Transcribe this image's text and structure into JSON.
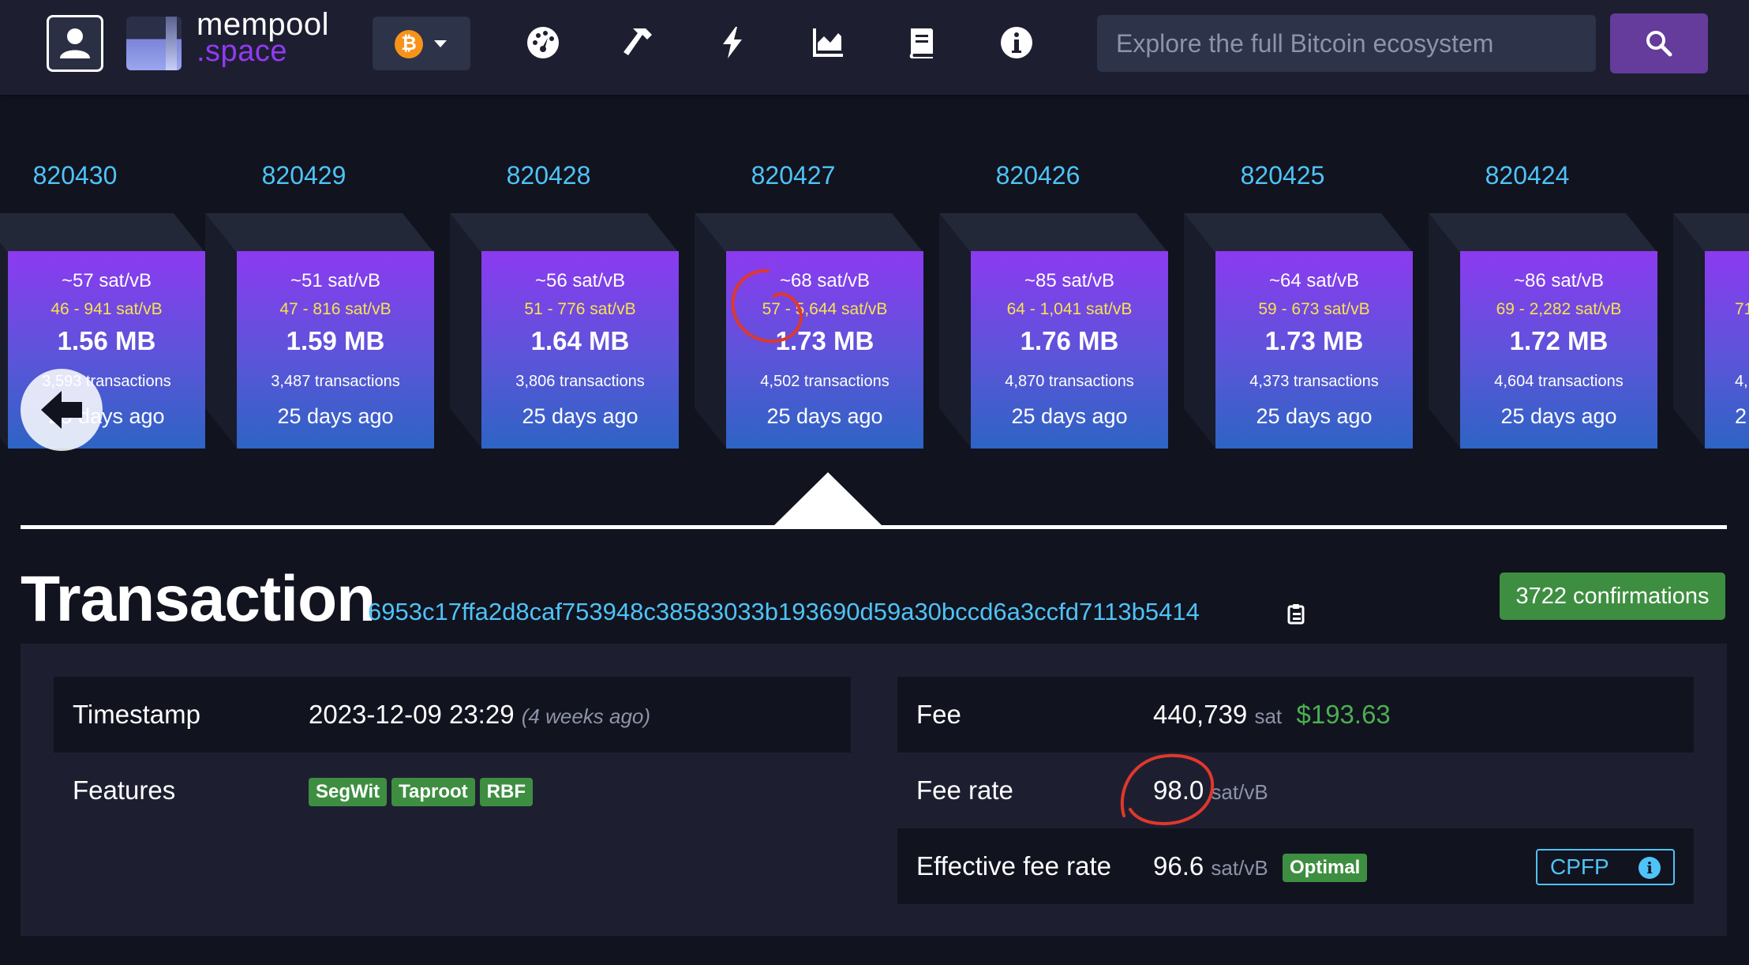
{
  "header": {
    "logo_line1": "mempool",
    "logo_line2": ".space",
    "network_symbol": "₿",
    "nav_icons": [
      "dashboard-icon",
      "mining-hammer-icon",
      "lightning-icon",
      "graphs-icon",
      "docs-book-icon",
      "about-info-icon"
    ],
    "search_placeholder": "Explore the full Bitcoin ecosystem"
  },
  "blocks": [
    {
      "height": "820430",
      "median_fee": "~57 sat/vB",
      "fee_range": "46 - 941 sat/vB",
      "size": "1.56 MB",
      "tx_count": "3,593 transactions",
      "time": "25 days ago"
    },
    {
      "height": "820429",
      "median_fee": "~51 sat/vB",
      "fee_range": "47 - 816 sat/vB",
      "size": "1.59 MB",
      "tx_count": "3,487 transactions",
      "time": "25 days ago"
    },
    {
      "height": "820428",
      "median_fee": "~56 sat/vB",
      "fee_range": "51 - 776 sat/vB",
      "size": "1.64 MB",
      "tx_count": "3,806 transactions",
      "time": "25 days ago"
    },
    {
      "height": "820427",
      "median_fee": "~68 sat/vB",
      "fee_range": "57 - 5,644 sat/vB",
      "size": "1.73 MB",
      "tx_count": "4,502 transactions",
      "time": "25 days ago"
    },
    {
      "height": "820426",
      "median_fee": "~85 sat/vB",
      "fee_range": "64 - 1,041 sat/vB",
      "size": "1.76 MB",
      "tx_count": "4,870 transactions",
      "time": "25 days ago"
    },
    {
      "height": "820425",
      "median_fee": "~64 sat/vB",
      "fee_range": "59 - 673 sat/vB",
      "size": "1.73 MB",
      "tx_count": "4,373 transactions",
      "time": "25 days ago"
    },
    {
      "height": "820424",
      "median_fee": "~86 sat/vB",
      "fee_range": "69 - 2,282 sat/vB",
      "size": "1.72 MB",
      "tx_count": "4,604 transactions",
      "time": "25 days ago"
    },
    {
      "height": "8",
      "median_fee": "",
      "fee_range": "71",
      "size": "",
      "tx_count": "4,",
      "time": "2"
    }
  ],
  "transaction": {
    "title": "Transaction",
    "txid": "6953c17ffa2d8caf753948c38583033b193690d59a30bccd6a3ccfd7113b5414",
    "confirmations": "3722 confirmations",
    "timestamp_label": "Timestamp",
    "timestamp_value": "2023-12-09 23:29",
    "timestamp_relative": "(4 weeks ago)",
    "features_label": "Features",
    "features": [
      "SegWit",
      "Taproot",
      "RBF"
    ],
    "fee_label": "Fee",
    "fee_value": "440,739",
    "fee_unit": "sat",
    "fee_usd": "$193.63",
    "fee_rate_label": "Fee rate",
    "fee_rate_value": "98.0",
    "fee_rate_unit": "sat/vB",
    "eff_fee_rate_label": "Effective fee rate",
    "eff_fee_rate_value": "96.6",
    "eff_fee_rate_unit": "sat/vB",
    "eff_fee_badge": "Optimal",
    "cpfp_label": "CPFP",
    "cpfp_info_glyph": "i"
  },
  "colors": {
    "background": "#11131f",
    "header": "#1d1f31",
    "accent_blue": "#4fc3f7",
    "fee_range_yellow": "#f7e44e",
    "badge_green": "#3e8e41",
    "usd_green": "#4caf50",
    "annotation_red": "#e0382b"
  }
}
